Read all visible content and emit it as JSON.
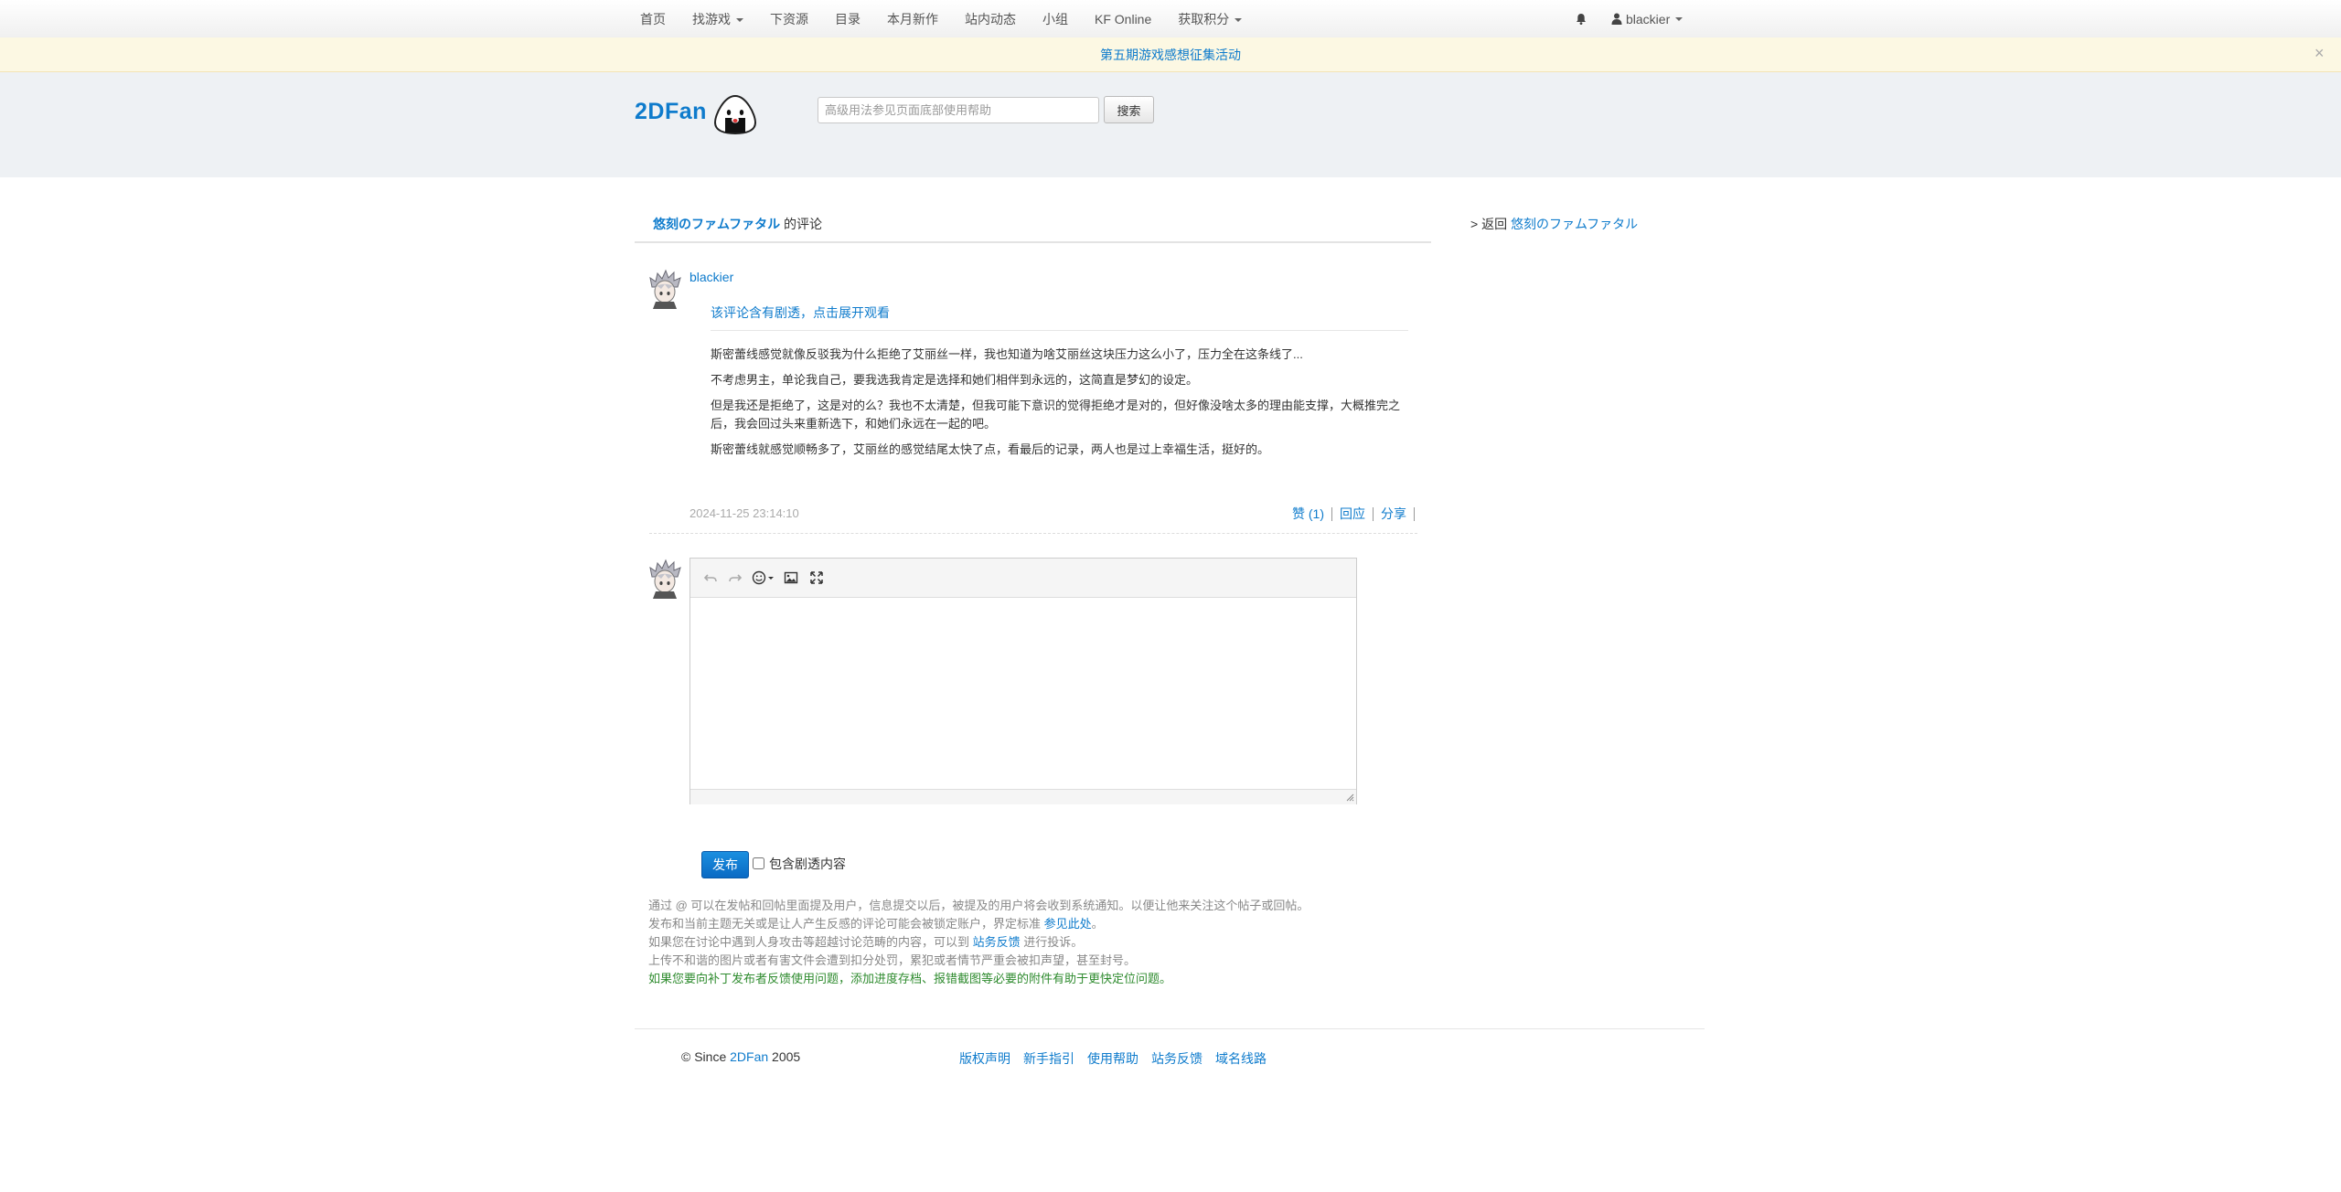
{
  "nav": {
    "items": [
      {
        "label": "首页",
        "dropdown": false
      },
      {
        "label": "找游戏",
        "dropdown": true
      },
      {
        "label": "下资源",
        "dropdown": false
      },
      {
        "label": "目录",
        "dropdown": false
      },
      {
        "label": "本月新作",
        "dropdown": false
      },
      {
        "label": "站内动态",
        "dropdown": false
      },
      {
        "label": "小组",
        "dropdown": false
      },
      {
        "label": "KF Online",
        "dropdown": false
      },
      {
        "label": "获取积分",
        "dropdown": true
      }
    ],
    "username": "blackier"
  },
  "announcement": {
    "text": "第五期游戏感想征集活动",
    "close": "×"
  },
  "header": {
    "logo": "2DFan",
    "search_placeholder": "高级用法参见页面底部使用帮助",
    "search_button": "搜索"
  },
  "review": {
    "game_title": "悠刻のファムファタル",
    "title_suffix": " 的评论",
    "back_prefix": "> 返回 ",
    "back_game": "悠刻のファムファタル",
    "author": "blackier",
    "spoiler_toggle": "该评论含有剧透，点击展开观看",
    "paragraphs": [
      "斯密蕾线感觉就像反驳我为什么拒绝了艾丽丝一样，我也知道为啥艾丽丝这块压力这么小了，压力全在这条线了...",
      "不考虑男主，单论我自己，要我选我肯定是选择和她们相伴到永远的，这简直是梦幻的设定。",
      "但是我还是拒绝了，这是对的么？我也不太清楚，但我可能下意识的觉得拒绝才是对的，但好像没啥太多的理由能支撑，大概推完之后，我会回过头来重新选下，和她们永远在一起的吧。",
      "斯密蕾线就感觉顺畅多了，艾丽丝的感觉结尾太快了点，看最后的记录，两人也是过上幸福生活，挺好的。"
    ],
    "timestamp": "2024-11-25 23:14:10",
    "like_label": "赞 (1)",
    "reply_label": "回应",
    "share_label": "分享"
  },
  "editor": {
    "publish_button": "发布",
    "spoiler_checkbox_label": "包含剧透内容"
  },
  "notes": {
    "line1": "通过 @ 可以在发帖和回帖里面提及用户，信息提交以后，被提及的用户将会收到系统通知。以便让他来关注这个帖子或回帖。",
    "line2_text": "发布和当前主题无关或是让人产生反感的评论可能会被锁定账户，界定标准 ",
    "line2_link": "参见此处",
    "line2_end": "。",
    "line3_text": "如果您在讨论中遇到人身攻击等超越讨论范畴的内容，可以到 ",
    "line3_link": "站务反馈",
    "line3_end": " 进行投诉。",
    "line4": "上传不和谐的图片或者有害文件会遭到扣分处罚，累犯或者情节严重会被扣声望，甚至封号。",
    "line5": "如果您要向补丁发布者反馈使用问题，添加进度存档、报错截图等必要的附件有助于更快定位问题。"
  },
  "footer": {
    "copyright_prefix": "© Since ",
    "site": "2DFan",
    "copyright_suffix": " 2005",
    "links": [
      "版权声明",
      "新手指引",
      "使用帮助",
      "站务反馈",
      "域名线路"
    ]
  },
  "colors": {
    "link": "#0e7bcc",
    "announce_bg": "#fcf8e3",
    "header_bg": "#eef1f4",
    "publish": "#0a6ac4",
    "note_green": "#2e8b2e"
  }
}
